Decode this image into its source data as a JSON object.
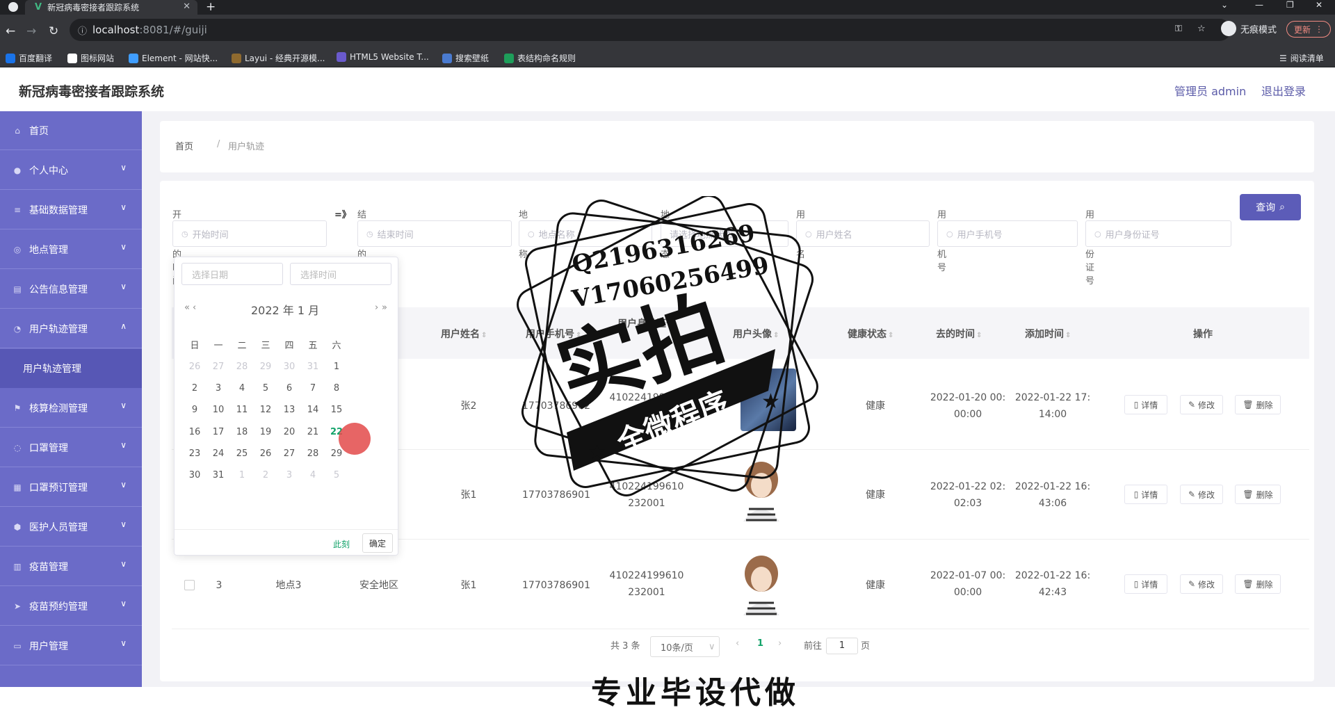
{
  "browser": {
    "tab_title": "新冠病毒密接者跟踪系统",
    "url_host": "localhost",
    "url_path": ":8081/#/guiji",
    "incognito_label": "无痕模式",
    "update_label": "更新",
    "reading_list": "阅读清单",
    "bookmarks": [
      "百度翻译",
      "图标网站",
      "Element - 网站快...",
      "Layui - 经典开源模...",
      "HTML5 Website T...",
      "搜索壁纸",
      "表结构命名规则"
    ]
  },
  "header": {
    "title": "新冠病毒密接者跟踪系统",
    "admin": "管理员 admin",
    "logout": "退出登录"
  },
  "sidebar": {
    "items": [
      {
        "label": "首页",
        "icon": "home-icon"
      },
      {
        "label": "个人中心",
        "icon": "user-icon"
      },
      {
        "label": "基础数据管理",
        "icon": "sliders-icon"
      },
      {
        "label": "地点管理",
        "icon": "globe-icon"
      },
      {
        "label": "公告信息管理",
        "icon": "briefcase-icon"
      },
      {
        "label": "用户轨迹管理",
        "icon": "compass-icon"
      },
      {
        "label": "用户轨迹管理",
        "icon": ""
      },
      {
        "label": "核算检测管理",
        "icon": "flag-icon"
      },
      {
        "label": "口罩管理",
        "icon": "power-icon"
      },
      {
        "label": "口罩预订管理",
        "icon": "clipboard-icon"
      },
      {
        "label": "医护人员管理",
        "icon": "shield-icon"
      },
      {
        "label": "疫苗管理",
        "icon": "bar-chart-icon"
      },
      {
        "label": "疫苗预约管理",
        "icon": "send-icon"
      },
      {
        "label": "用户管理",
        "icon": "keyboard-icon"
      }
    ]
  },
  "breadcrumb": {
    "home": "首页",
    "sep": "/",
    "current": "用户轨迹"
  },
  "filters": {
    "start_label": "开始去的时间",
    "arrow": "=》",
    "end_label": "结束去的时间",
    "place_label": "地点名称",
    "status_label": "地点状态",
    "name_label": "用户姓名",
    "phone_label": "用户手机号",
    "id_label": "用户身份证号",
    "start_ph": "开始时间",
    "end_ph": "结束时间",
    "place_ph": "地点名称",
    "status_ph": "请选择地点状态",
    "name_ph": "用户姓名",
    "phone_ph": "用户手机号",
    "id_ph": "用户身份证号",
    "search_btn": "查询"
  },
  "datepicker": {
    "date_ph": "选择日期",
    "time_ph": "选择时间",
    "title": "2022 年  1 月",
    "weekdays": [
      "日",
      "一",
      "二",
      "三",
      "四",
      "五",
      "六"
    ],
    "weeks": [
      [
        "26",
        "27",
        "28",
        "29",
        "30",
        "31",
        "1"
      ],
      [
        "2",
        "3",
        "4",
        "5",
        "6",
        "7",
        "8"
      ],
      [
        "9",
        "10",
        "11",
        "12",
        "13",
        "14",
        "15"
      ],
      [
        "16",
        "17",
        "18",
        "19",
        "20",
        "21",
        "22"
      ],
      [
        "23",
        "24",
        "25",
        "26",
        "27",
        "28",
        "29"
      ],
      [
        "30",
        "31",
        "1",
        "2",
        "3",
        "4",
        "5"
      ]
    ],
    "now_label": "此刻",
    "ok_label": "确定"
  },
  "table": {
    "headers": [
      "用户姓名",
      "用户手机号",
      "用户身份证号",
      "用户头像",
      "健康状态",
      "去的时间",
      "添加时间",
      "操作"
    ],
    "rows": [
      {
        "index": "",
        "place": "",
        "status": "",
        "name": "张2",
        "phone": "17703786902",
        "idcard_1": "41022419961​0",
        "idcard_2": "232002",
        "health": "健康",
        "go_1": "2022-01-20 00:",
        "go_2": "00:00",
        "add_1": "2022-01-22 17:",
        "add_2": "14:00"
      },
      {
        "index": "",
        "place": "",
        "status": "",
        "name": "张1",
        "phone": "17703786901",
        "idcard_1": "410224199610",
        "idcard_2": "232001",
        "health": "健康",
        "go_1": "2022-01-22 02:",
        "go_2": "02:03",
        "add_1": "2022-01-22 16:",
        "add_2": "43:06"
      },
      {
        "index": "3",
        "place": "地点3",
        "status": "安全地区",
        "name": "张1",
        "phone": "17703786901",
        "idcard_1": "410224199610",
        "idcard_2": "232001",
        "health": "健康",
        "go_1": "2022-01-07 00:",
        "go_2": "00:00",
        "add_1": "2022-01-22 16:",
        "add_2": "42:43"
      }
    ],
    "op_detail": "详情",
    "op_edit": "修改",
    "op_delete": "删除"
  },
  "pagination": {
    "total": "共 3 条",
    "size": "10条/页",
    "current": "1",
    "goto": "前往",
    "goto_val": "1",
    "page_unit": "页"
  },
  "watermark": {
    "line1": "Q2196316269",
    "line2": "V17060256499",
    "big": "实拍",
    "ribbon": "全微程序",
    "bottom": "专业毕设代做"
  }
}
